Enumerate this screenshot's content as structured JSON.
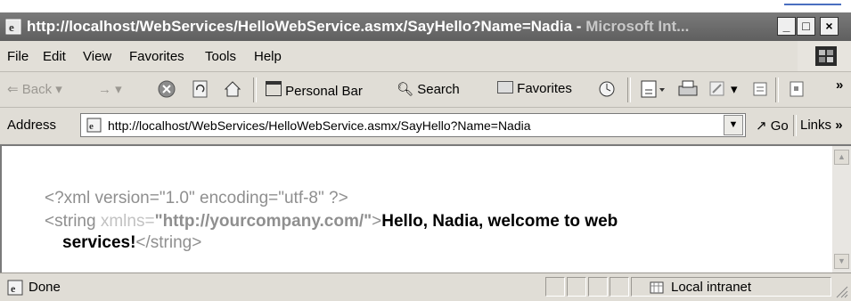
{
  "window": {
    "title_main": "http://localhost/WebServices/HelloWebService.asmx/SayHello?Name=Nadia - ",
    "title_app": "Microsoft Int...",
    "buttons": {
      "minimize": "_",
      "maximize": "□",
      "close": "×"
    }
  },
  "menu": {
    "items": [
      {
        "label": "File"
      },
      {
        "label": "Edit"
      },
      {
        "label": "View"
      },
      {
        "label": "Favorites"
      },
      {
        "label": "Tools"
      },
      {
        "label": "Help"
      }
    ]
  },
  "toolbar": {
    "back": "Back",
    "personal_bar": "Personal Bar",
    "search": "Search",
    "favorites": "Favorites",
    "chevron": "»"
  },
  "address": {
    "label": "Address",
    "url": "http://localhost/WebServices/HelloWebService.asmx/SayHello?Name=Nadia",
    "go": "Go",
    "links": "Links",
    "chevron": "»"
  },
  "content": {
    "line1": "<?xml version=\"1.0\" encoding=\"utf-8\" ?>",
    "line2_open": "<string ",
    "line2_attr": "xmlns=",
    "line2_value": "\"http://yourcompany.com/\"",
    "line2_close": ">",
    "line2_text": "Hello, Nadia, welcome to web",
    "line3_text": "services!",
    "line3_end": "</string>"
  },
  "status": {
    "text": "Done",
    "zone": "Local intranet"
  }
}
